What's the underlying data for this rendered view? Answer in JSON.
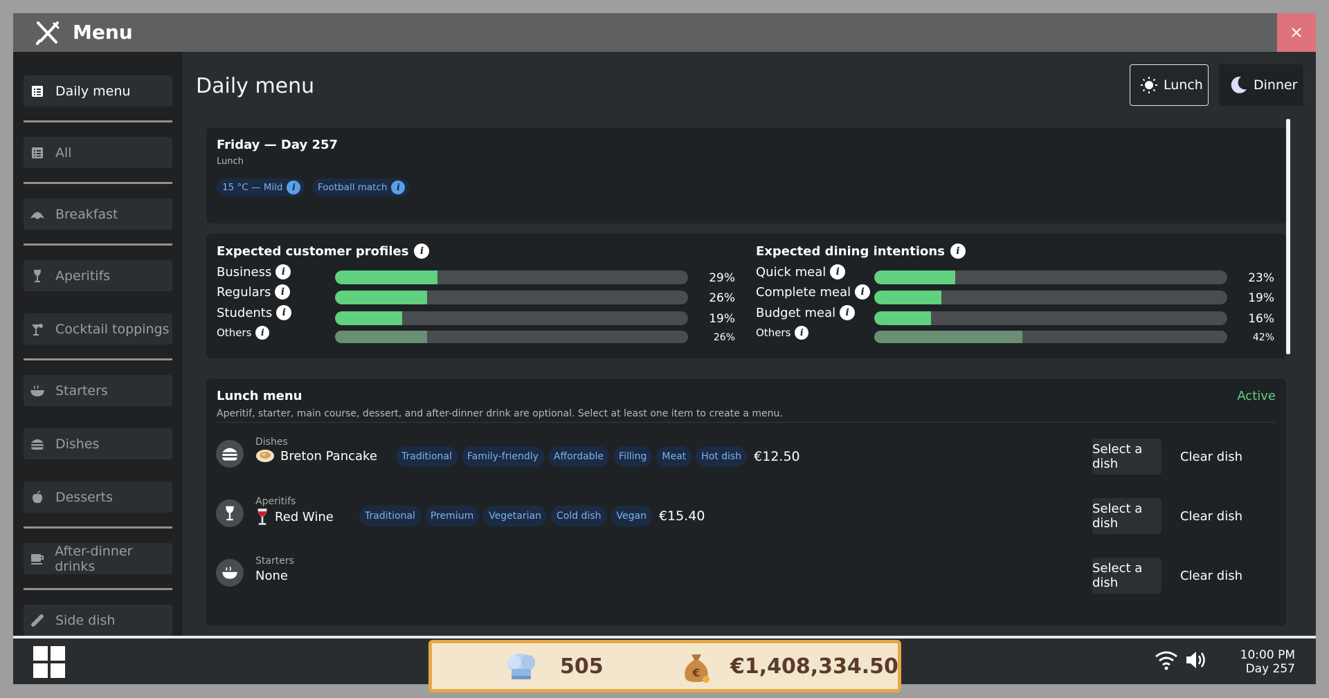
{
  "window": {
    "title": "Menu"
  },
  "sidebar": {
    "items": [
      {
        "label": "Daily menu",
        "icon": "list-icon"
      },
      {
        "label": "All",
        "icon": "list-icon"
      },
      {
        "label": "Breakfast",
        "icon": "croissant-icon"
      },
      {
        "label": "Aperitifs",
        "icon": "wine-glass-icon"
      },
      {
        "label": "Cocktail toppings",
        "icon": "cocktail-icon"
      },
      {
        "label": "Starters",
        "icon": "bowl-icon"
      },
      {
        "label": "Dishes",
        "icon": "burger-icon"
      },
      {
        "label": "Desserts",
        "icon": "apple-icon"
      },
      {
        "label": "After-dinner drinks",
        "icon": "coffee-icon"
      },
      {
        "label": "Side dish",
        "icon": "baguette-icon"
      }
    ]
  },
  "header": {
    "title": "Daily menu",
    "lunch_label": "Lunch",
    "dinner_label": "Dinner"
  },
  "day": {
    "title": "Friday — Day 257",
    "subtitle": "Lunch",
    "chips": [
      "15 °C — Mild",
      "Football match"
    ]
  },
  "profiles": {
    "title": "Expected customer profiles",
    "rows": [
      {
        "label": "Business",
        "value": 29,
        "pct": "29%"
      },
      {
        "label": "Regulars",
        "value": 26,
        "pct": "26%"
      },
      {
        "label": "Students",
        "value": 19,
        "pct": "19%"
      },
      {
        "label": "Others",
        "value": 26,
        "pct": "26%"
      }
    ]
  },
  "intentions": {
    "title": "Expected dining intentions",
    "rows": [
      {
        "label": "Quick meal",
        "value": 23,
        "pct": "23%"
      },
      {
        "label": "Complete meal",
        "value": 19,
        "pct": "19%"
      },
      {
        "label": "Budget meal",
        "value": 16,
        "pct": "16%"
      },
      {
        "label": "Others",
        "value": 42,
        "pct": "42%"
      }
    ]
  },
  "lunch_menu": {
    "title": "Lunch menu",
    "description": "Aperitif, starter, main course, dessert, and after-dinner drink are optional. Select at least one item to create a menu.",
    "status": "Active",
    "select_label": "Select a dish",
    "clear_label": "Clear dish",
    "rows": [
      {
        "category": "Dishes",
        "name": "Breton Pancake",
        "tags": [
          "Traditional",
          "Family-friendly",
          "Affordable",
          "Filling",
          "Meat",
          "Hot dish"
        ],
        "price": "€12.50"
      },
      {
        "category": "Aperitifs",
        "name": "Red Wine",
        "tags": [
          "Traditional",
          "Premium",
          "Vegetarian",
          "Cold dish",
          "Vegan"
        ],
        "price": "€15.40"
      },
      {
        "category": "Starters",
        "name": "None",
        "tags": [],
        "price": ""
      }
    ]
  },
  "taskbar": {
    "reputation": "505",
    "money": "€1,408,334.50",
    "time": "10:00 PM",
    "day": "Day 257"
  },
  "colors": {
    "accent_green": "#5fd17f",
    "tag_blue": "#7fb1ea",
    "close_red": "#e0727c"
  }
}
